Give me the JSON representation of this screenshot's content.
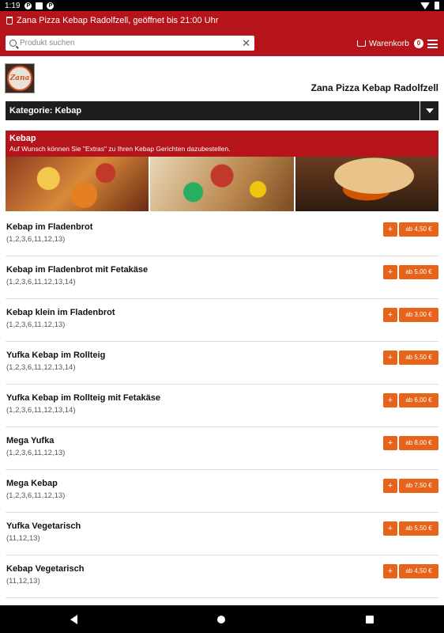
{
  "status_bar": {
    "time": "1:19",
    "icons": [
      "notification-icon",
      "sim-icon",
      "notification-icon",
      "wifi-icon",
      "battery-icon"
    ]
  },
  "header": {
    "shop_status": "Zana Pizza Kebap Radolfzell, geöffnet bis 21:00 Uhr",
    "search_placeholder": "Produkt suchen",
    "cart_label": "Warenkorb",
    "cart_count": "0"
  },
  "restaurant": {
    "logo_text": "Zana",
    "name": "Zana Pizza Kebap Radolfzell"
  },
  "category_select": {
    "label": "Kategorie: Kebap"
  },
  "category": {
    "title": "Kebap",
    "subtitle": "Auf Wunsch können Sie \"Extras\" zu Ihren Kebap Gerichten dazubestellen."
  },
  "items": [
    {
      "name": "Kebap im Fladenbrot",
      "allergens": "(1,2,3,6,11,12,13)",
      "price": "ab 4,50 €"
    },
    {
      "name": "Kebap im Fladenbrot mit Fetakäse",
      "allergens": "(1,2,3,6,11,12,13,14)",
      "price": "ab 5,00 €"
    },
    {
      "name": "Kebap klein im Fladenbrot",
      "allergens": "(1,2,3,6,11,12,13)",
      "price": "ab 3,00 €"
    },
    {
      "name": "Yufka Kebap im Rollteig",
      "allergens": "(1,2,3,6,11,12,13,14)",
      "price": "ab 5,50 €"
    },
    {
      "name": "Yufka Kebap im Rollteig mit Fetakäse",
      "allergens": "(1,2,3,6,11,12,13,14)",
      "price": "ab 6,00 €"
    },
    {
      "name": "Mega Yufka",
      "allergens": "(1,2,3,6,11,12,13)",
      "price": "ab 8,00 €"
    },
    {
      "name": "Mega Kebap",
      "allergens": "(1,2,3,6,11,12,13)",
      "price": "ab 7,50 €"
    },
    {
      "name": "Yufka Vegetarisch",
      "allergens": "(11,12,13)",
      "price": "ab 5,50 €"
    },
    {
      "name": "Kebap Vegetarisch",
      "allergens": "(11,12,13)",
      "price": "ab 4,50 €"
    }
  ],
  "add_label": "+",
  "colors": {
    "brand_red": "#b5151a",
    "accent_orange": "#e8631a",
    "category_bar": "#1e1e1e"
  }
}
